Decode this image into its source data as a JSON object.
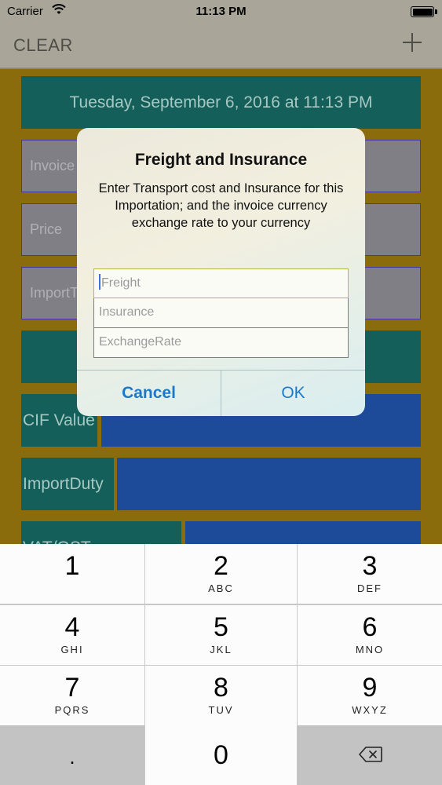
{
  "status_bar": {
    "carrier": "Carrier",
    "time": "11:13 PM",
    "wifi_icon": "wifi-icon",
    "battery_icon": "battery-icon",
    "battery_level": 1.0
  },
  "nav_bar": {
    "left_button": "CLEAR",
    "right_button_icon": "plus-icon"
  },
  "main": {
    "date": "Tuesday, September 6, 2016 at 11:13 PM",
    "fields": [
      {
        "placeholder": "Invoice"
      },
      {
        "placeholder": "Price"
      },
      {
        "placeholder": "ImportT"
      }
    ],
    "rows": [
      {
        "label": "CIF Value"
      },
      {
        "label": "ImportDuty"
      },
      {
        "label": "VAT/GST"
      }
    ]
  },
  "alert": {
    "title": "Freight and Insurance",
    "message": "Enter Transport cost and Insurance for this Importation; and the invoice currency exchange rate to your currency",
    "inputs": [
      {
        "placeholder": "Freight",
        "value": ""
      },
      {
        "placeholder": "Insurance",
        "value": ""
      },
      {
        "placeholder": "ExchangeRate",
        "value": ""
      }
    ],
    "cancel_label": "Cancel",
    "ok_label": "OK"
  },
  "keypad": {
    "keys": [
      {
        "num": "1",
        "letters": ""
      },
      {
        "num": "2",
        "letters": "ABC"
      },
      {
        "num": "3",
        "letters": "DEF"
      },
      {
        "num": "4",
        "letters": "GHI"
      },
      {
        "num": "5",
        "letters": "JKL"
      },
      {
        "num": "6",
        "letters": "MNO"
      },
      {
        "num": "7",
        "letters": "PQRS"
      },
      {
        "num": "8",
        "letters": "TUV"
      },
      {
        "num": "9",
        "letters": "WXYZ"
      }
    ],
    "dot": ".",
    "zero": "0",
    "backspace_icon": "backspace-icon"
  },
  "colors": {
    "background": "#8a6c0c",
    "teal": "#145f59",
    "blue": "#1d4a99",
    "alert_button": "#1c79c8"
  }
}
